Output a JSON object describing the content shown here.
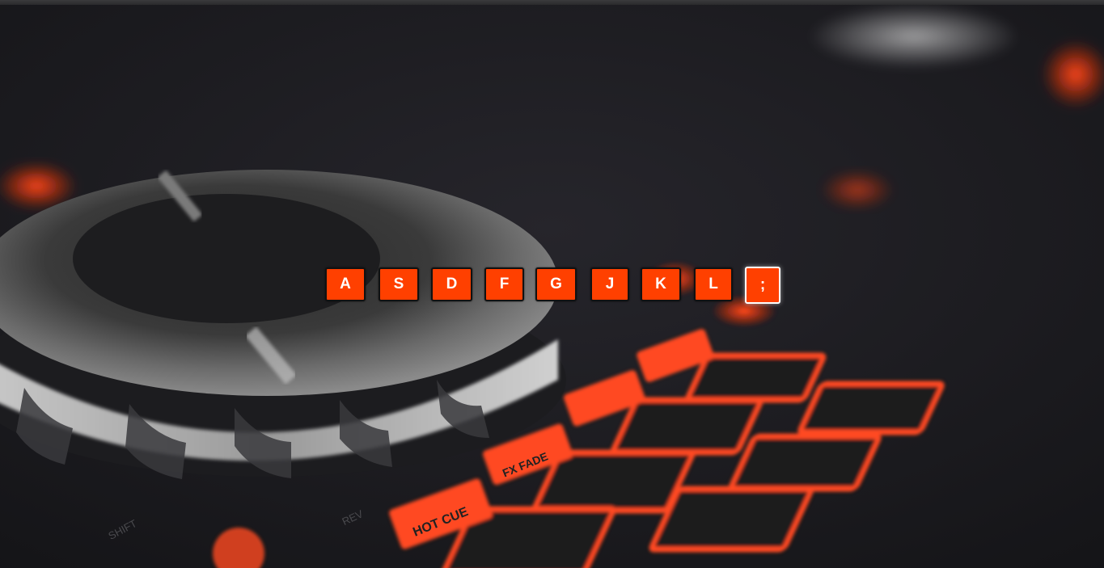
{
  "keys": [
    {
      "label": "A",
      "active": false
    },
    {
      "label": "S",
      "active": false
    },
    {
      "label": "D",
      "active": false
    },
    {
      "label": "F",
      "active": false
    },
    {
      "label": "G",
      "active": false
    },
    {
      "label": "J",
      "active": false
    },
    {
      "label": "K",
      "active": false
    },
    {
      "label": "L",
      "active": false
    },
    {
      "label": ";",
      "active": true
    }
  ],
  "background": {
    "photo_labels": {
      "hot_cue": "HOT CUE",
      "fx_fade": "FX FADE",
      "shift": "SHIFT",
      "rev": "REV"
    }
  },
  "colors": {
    "key_fill": "#ff4000",
    "key_border": "#111111",
    "key_text": "#ffffff",
    "pad_glow": "#ff3a10",
    "background_dark": "#1a1a1e"
  }
}
